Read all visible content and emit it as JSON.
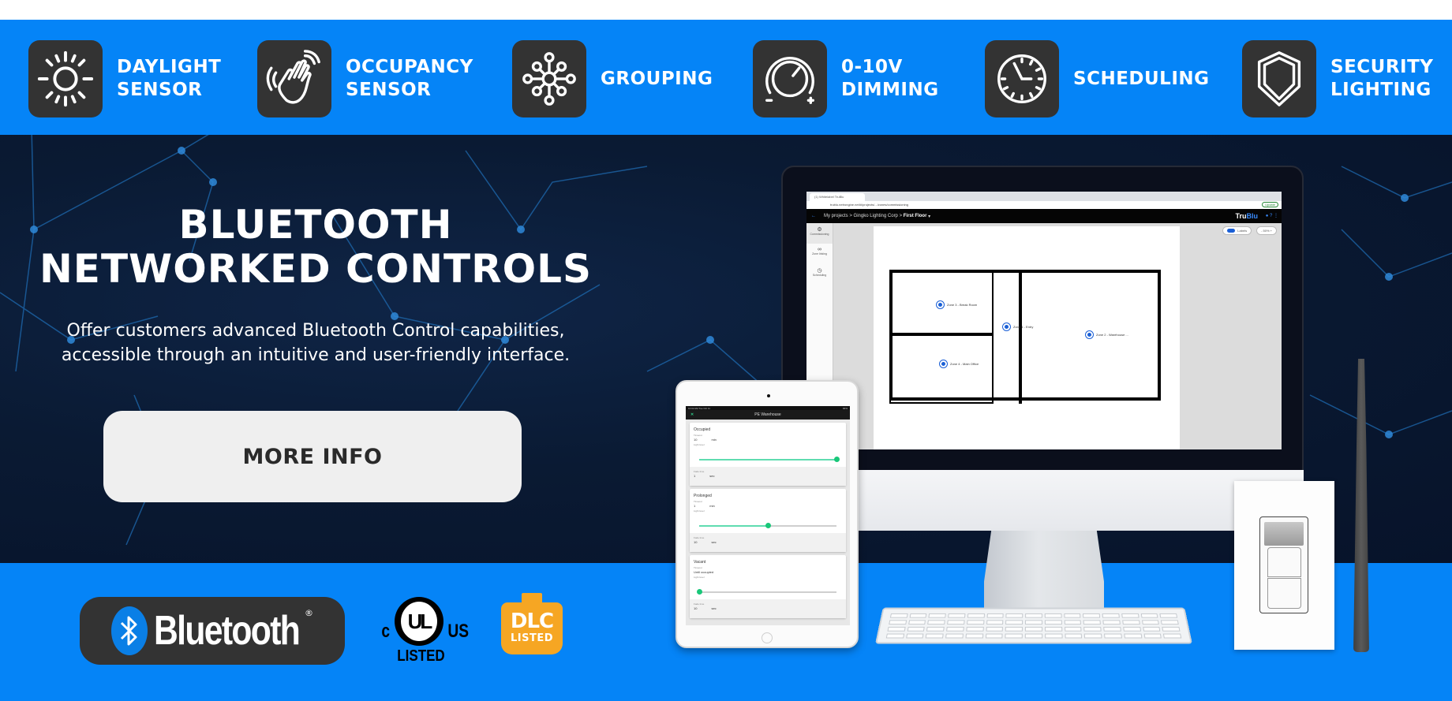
{
  "colors": {
    "band_blue": "#0584f7",
    "icon_tile": "#333333",
    "hero_bg": "#0a1a33",
    "button_bg": "#efefef",
    "bluetooth_blue": "#0a7fe6",
    "dlc_orange": "#f6a623",
    "slider_green": "#19c779"
  },
  "features": [
    {
      "icon": "sun-icon",
      "label": "DAYLIGHT\nSENSOR"
    },
    {
      "icon": "waving-hand-icon",
      "label": "OCCUPANCY\nSENSOR"
    },
    {
      "icon": "network-nodes-icon",
      "label": "GROUPING"
    },
    {
      "icon": "dimmer-knob-icon",
      "label": "0-10V\nDIMMING"
    },
    {
      "icon": "clock-icon",
      "label": "SCHEDULING"
    },
    {
      "icon": "shield-icon",
      "label": "SECURITY\nLIGHTING"
    }
  ],
  "hero": {
    "title_line1": "BLUETOOTH",
    "title_line2": "NETWORKED CONTROLS",
    "subtitle_line1": "Offer customers advanced Bluetooth Control capabilities,",
    "subtitle_line2": "accessible through an intuitive and user-friendly interface.",
    "cta_label": "MORE INFO"
  },
  "badges": {
    "bluetooth": {
      "word": "Bluetooth",
      "mark": "®"
    },
    "ul": {
      "c": "c",
      "ul": "UL",
      "us": "US",
      "listed": "LISTED"
    },
    "dlc": {
      "title": "DLC",
      "sub": "LISTED"
    }
  },
  "monitor_app": {
    "tab_title": "(1) Whitelabel TruBlu",
    "url": "trublu.netrongine.net/#/projects/.../zones/commissioning",
    "update_label": "Update",
    "breadcrumb": [
      "My projects",
      "Gingko Lighting Corp",
      "First Floor"
    ],
    "brand_a": "Tru",
    "brand_b": "Blu",
    "sidebar": [
      "Commissioning",
      "Zone linking",
      "Scheduling"
    ],
    "labels_toggle": "Labels",
    "zoom_level": "- 50% +",
    "zones": [
      "Zone 3 - Break Room",
      "Zone 1 - Entry",
      "Zone 2 - Warehouse ...",
      "Zone 4 - Main Office"
    ]
  },
  "tablet_app": {
    "status_time": "10:02 AM   Tue Oct 11",
    "status_right": "84%",
    "header_title": "PE Warehouse",
    "cards": [
      {
        "title": "Occupied",
        "timeout_label": "Timeout",
        "timeout": "10",
        "timeout_unit": "min",
        "light_label": "Light level",
        "light_level": 1.0,
        "fade_label": "Fade time",
        "fade": "1",
        "fade_unit": "sec"
      },
      {
        "title": "Prolonged",
        "timeout_label": "Timeout",
        "timeout": "1",
        "timeout_unit": "min",
        "light_label": "Light level",
        "light_level": 0.5,
        "fade_label": "Fade time",
        "fade": "10",
        "fade_unit": "sec"
      },
      {
        "title": "Vacant",
        "timeout_label": "Timeout",
        "timeout": "Until occupied",
        "timeout_unit": "",
        "light_label": "Light level",
        "light_level": 0.0,
        "fade_label": "Fade time",
        "fade": "10",
        "fade_unit": "sec"
      }
    ]
  }
}
